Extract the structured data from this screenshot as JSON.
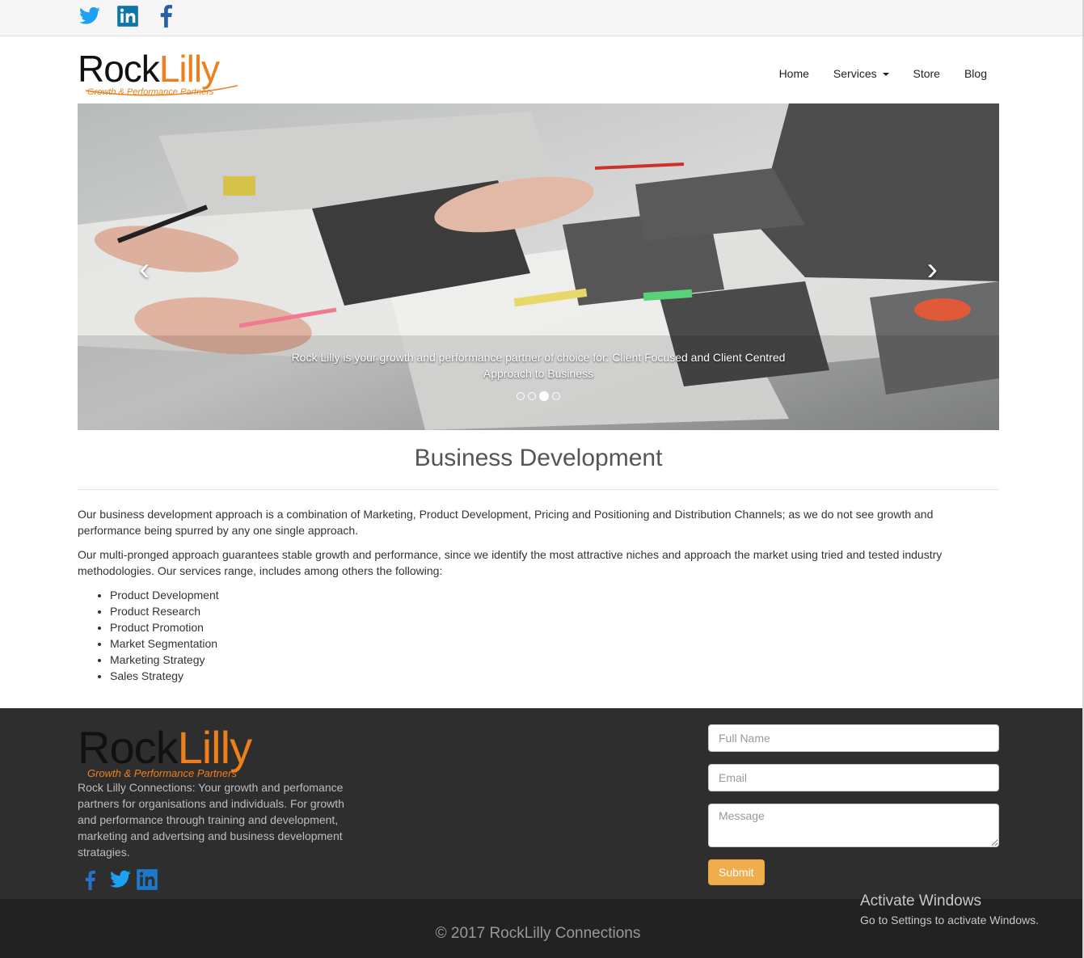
{
  "topbar": {
    "icons": [
      "twitter-icon",
      "linkedin-icon",
      "facebook-icon"
    ]
  },
  "logo": {
    "rock": "Rock",
    "lilly": "Lilly",
    "tagline": "Growth & Performance Partners"
  },
  "nav": {
    "items": [
      {
        "label": "Home"
      },
      {
        "label": "Services"
      },
      {
        "label": "Store"
      },
      {
        "label": "Blog"
      }
    ]
  },
  "carousel": {
    "prev_icon": "chevron-left-icon",
    "next_icon": "chevron-right-icon",
    "caption_line1": "Rock Lilly is your growth and performance partner of choice for:  Client Focused and Client Centred",
    "caption_line2": "Approach to Business",
    "slide_count": 4,
    "active_slide": 3
  },
  "main": {
    "heading": "Business Development",
    "paragraph1": "Our business development approach is a combination of Marketing, Product Development, Pricing and Positioning and Distribution Channels; as we do not see growth and performance being spurred by any one single approach.",
    "paragraph2": "Our multi-pronged approach guarantees stable growth and performance, since we identify the most attractive niches and approach the market using tried and tested industry methodologies. Our services range, includes among others the following:",
    "services": [
      "Product Development",
      "Product Research",
      "Product Promotion",
      "Market Segmentation",
      "Marketing Strategy",
      "Sales Strategy"
    ]
  },
  "footer": {
    "logo_rock": "Rock",
    "logo_lilly": "Lilly",
    "logo_tagline": "Growth & Performance Partners",
    "description": "Rock Lilly Connections: Your growth and perfomance partners for organisations and individuals. For growth and performance through training and development, marketing and advertsing and business development stratagies.",
    "social_icons": [
      "facebook-icon",
      "twitter-icon",
      "linkedin-icon"
    ],
    "form": {
      "name_placeholder": "Full Name",
      "email_placeholder": "Email",
      "message_placeholder": "Message",
      "submit_label": "Submit"
    },
    "copyright": "© 2017 RockLilly Connections"
  },
  "watermark": {
    "title": "Activate Windows",
    "subtitle": "Go to Settings to activate Windows."
  },
  "colors": {
    "brand_orange": "#ee7f1d",
    "submit_orange": "#f0ad4e",
    "footer_bg": "#2e2e2e",
    "twitter_blue": "#1da1f2",
    "linkedin_blue": "#0e76a8",
    "facebook_blue": "#3b5998"
  }
}
